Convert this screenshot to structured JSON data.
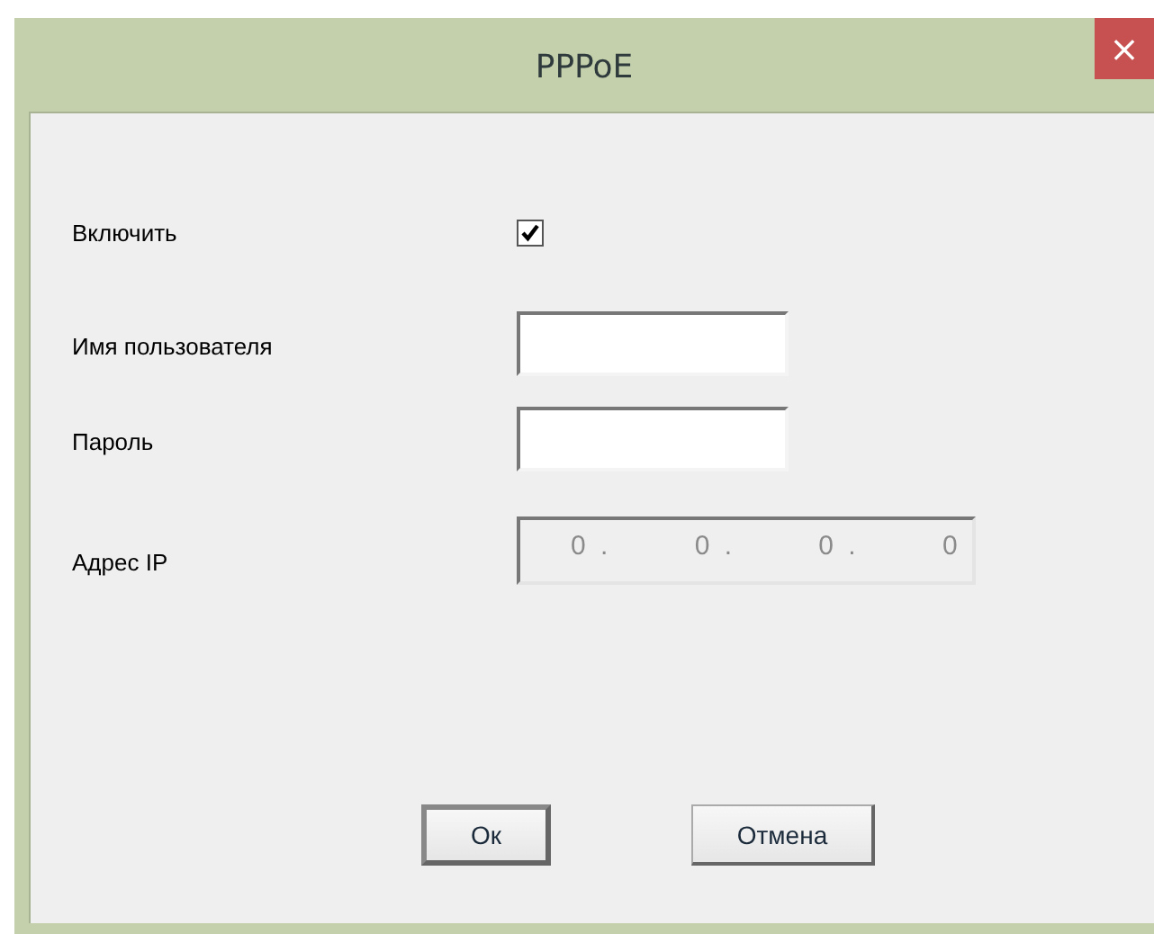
{
  "window": {
    "title": "PPPoE",
    "close": "×"
  },
  "rows": [
    {
      "kind": "checkbox",
      "label": "Включить",
      "checked": true
    },
    {
      "kind": "text",
      "label": "Имя пользователя"
    },
    {
      "kind": "text",
      "label": "Пароль"
    },
    {
      "kind": "ip",
      "label": "Адрес IP",
      "disabled": true,
      "octets": [
        "0",
        "0",
        "0",
        "0"
      ],
      "separator": "."
    }
  ],
  "buttons": [
    {
      "label": "Ок",
      "default": true
    },
    {
      "label": "Отмена",
      "default": false
    }
  ]
}
